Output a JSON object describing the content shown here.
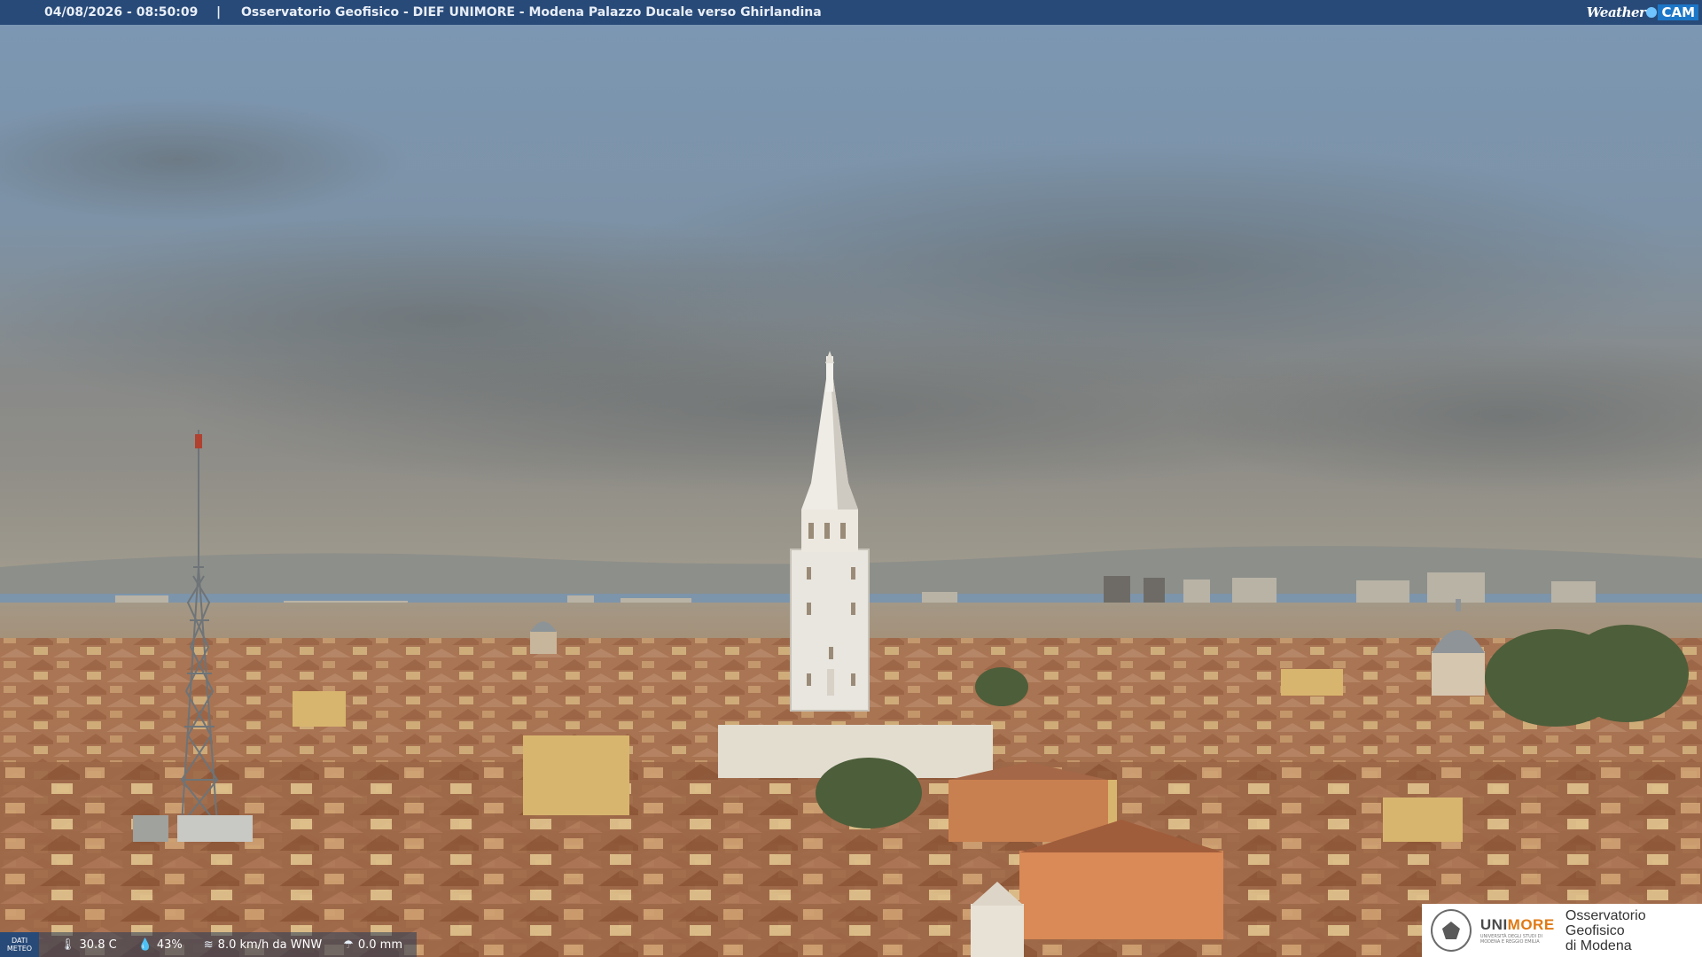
{
  "header": {
    "datetime": "04/08/2026 - 08:50:09",
    "separator": "|",
    "title": "Osservatorio Geofisico - DIEF UNIMORE - Modena Palazzo Ducale verso Ghirlandina",
    "logo": {
      "word1": "Weather",
      "word2": "CAM"
    }
  },
  "meteo": {
    "label_line1": "DATI",
    "label_line2": "METEO",
    "temperature": "30.8 C",
    "temperature_icon": "thermometer-icon",
    "humidity": "43%",
    "humidity_icon": "droplet-icon",
    "wind": "8.0 km/h da WNW",
    "wind_icon": "wind-icon",
    "rain": "0.0 mm",
    "rain_icon": "rain-icon"
  },
  "footer_logo": {
    "brand_a": "UNI",
    "brand_b": "MORE",
    "brand_sub": "UNIVERSITÀ DEGLI STUDI DI MODENA E REGGIO EMILIA",
    "obs_line1": "Osservatorio Geofisico",
    "obs_line2": "di Modena"
  },
  "colors": {
    "header_bg": "#284a78",
    "sky_top": "#7c98b6",
    "sky_bottom": "#8c8d8a",
    "roof": "#b07a58",
    "tower": "#e9e6df"
  }
}
